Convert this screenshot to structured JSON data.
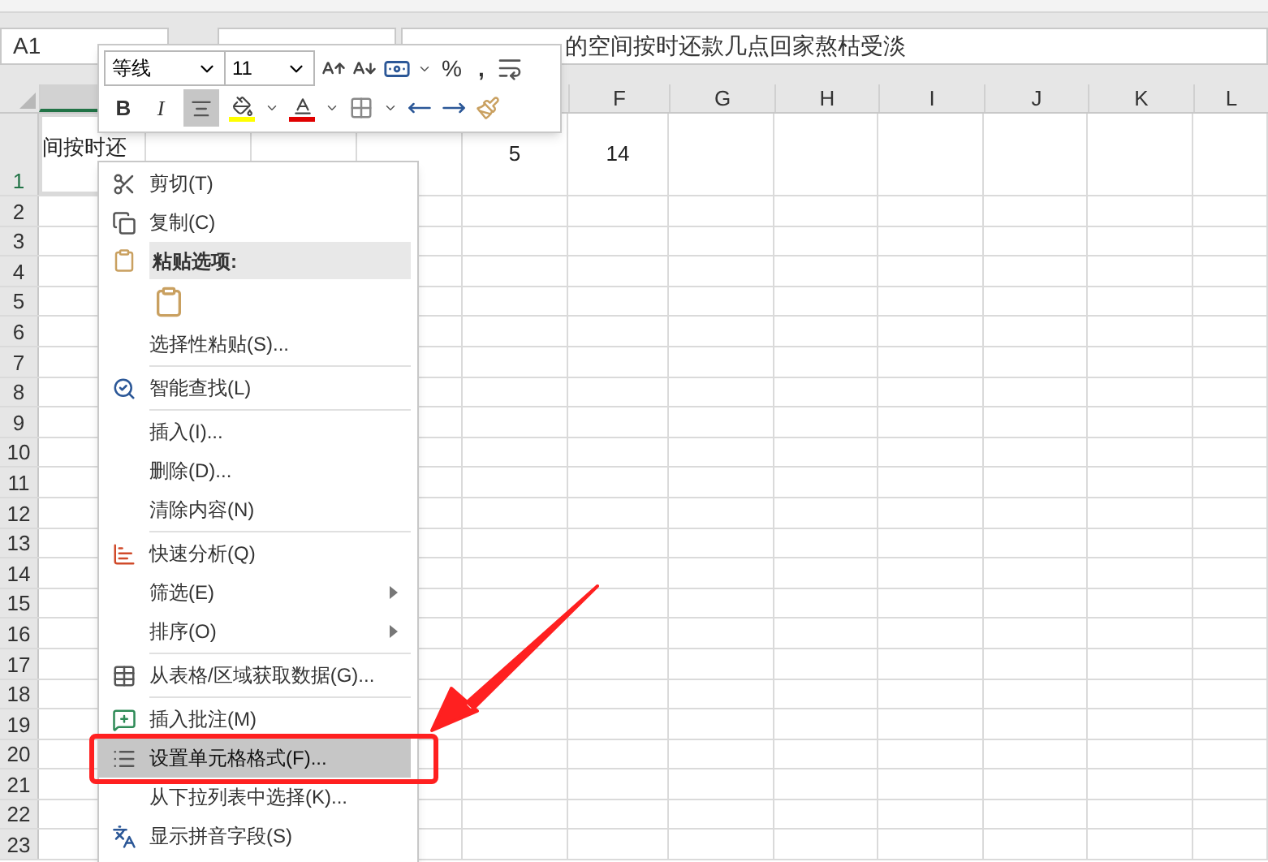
{
  "name_box": "A1",
  "formula_text": "的空间按时还款几点回家熬枯受淡",
  "column_headers": [
    "F",
    "G",
    "H",
    "I",
    "J",
    "K",
    "L"
  ],
  "rows": [
    {
      "label": "1",
      "selected": true,
      "cells": [
        "间按时还",
        "",
        "",
        "",
        "5",
        "14"
      ]
    },
    {
      "label": "2",
      "selected": false
    },
    {
      "label": "3",
      "selected": false
    },
    {
      "label": "4",
      "selected": false
    },
    {
      "label": "5",
      "selected": false
    },
    {
      "label": "6",
      "selected": false
    },
    {
      "label": "7",
      "selected": false
    },
    {
      "label": "8",
      "selected": false
    },
    {
      "label": "9",
      "selected": false
    },
    {
      "label": "10",
      "selected": false
    },
    {
      "label": "11",
      "selected": false
    },
    {
      "label": "12",
      "selected": false
    },
    {
      "label": "13",
      "selected": false
    },
    {
      "label": "14",
      "selected": false
    },
    {
      "label": "15",
      "selected": false
    },
    {
      "label": "16",
      "selected": false
    },
    {
      "label": "17",
      "selected": false
    },
    {
      "label": "18",
      "selected": false
    },
    {
      "label": "19",
      "selected": false
    },
    {
      "label": "20",
      "selected": false
    },
    {
      "label": "21",
      "selected": false
    },
    {
      "label": "22",
      "selected": false
    },
    {
      "label": "23",
      "selected": false
    }
  ],
  "mini_toolbar": {
    "font": "等线",
    "size": "11",
    "percent": "%",
    "comma": ",",
    "bold": "B",
    "italic": "I",
    "align_center_pressed": true
  },
  "context_menu": [
    {
      "kind": "item",
      "label": "剪切(T)",
      "selected": false,
      "submenu": false
    },
    {
      "kind": "item",
      "label": "复制(C)",
      "selected": false,
      "submenu": false
    },
    {
      "kind": "header",
      "label": "粘贴选项:"
    },
    {
      "kind": "paste-options"
    },
    {
      "kind": "item",
      "label": "选择性粘贴(S)...",
      "selected": false,
      "submenu": false
    },
    {
      "kind": "separator"
    },
    {
      "kind": "item",
      "label": "智能查找(L)",
      "selected": false,
      "submenu": false
    },
    {
      "kind": "separator"
    },
    {
      "kind": "item",
      "label": "插入(I)...",
      "selected": false,
      "submenu": false
    },
    {
      "kind": "item",
      "label": "删除(D)...",
      "selected": false,
      "submenu": false
    },
    {
      "kind": "item",
      "label": "清除内容(N)",
      "selected": false,
      "submenu": false
    },
    {
      "kind": "separator"
    },
    {
      "kind": "item",
      "label": "快速分析(Q)",
      "selected": false,
      "submenu": false
    },
    {
      "kind": "item",
      "label": "筛选(E)",
      "selected": false,
      "submenu": true
    },
    {
      "kind": "item",
      "label": "排序(O)",
      "selected": false,
      "submenu": true
    },
    {
      "kind": "separator"
    },
    {
      "kind": "item",
      "label": "从表格/区域获取数据(G)...",
      "selected": false,
      "submenu": false
    },
    {
      "kind": "separator"
    },
    {
      "kind": "item",
      "label": "插入批注(M)",
      "selected": false,
      "submenu": false
    },
    {
      "kind": "item",
      "label": "设置单元格格式(F)...",
      "selected": true,
      "submenu": false
    },
    {
      "kind": "item",
      "label": "从下拉列表中选择(K)...",
      "selected": false,
      "submenu": false
    },
    {
      "kind": "item",
      "label": "显示拼音字段(S)",
      "selected": false,
      "submenu": false
    }
  ]
}
